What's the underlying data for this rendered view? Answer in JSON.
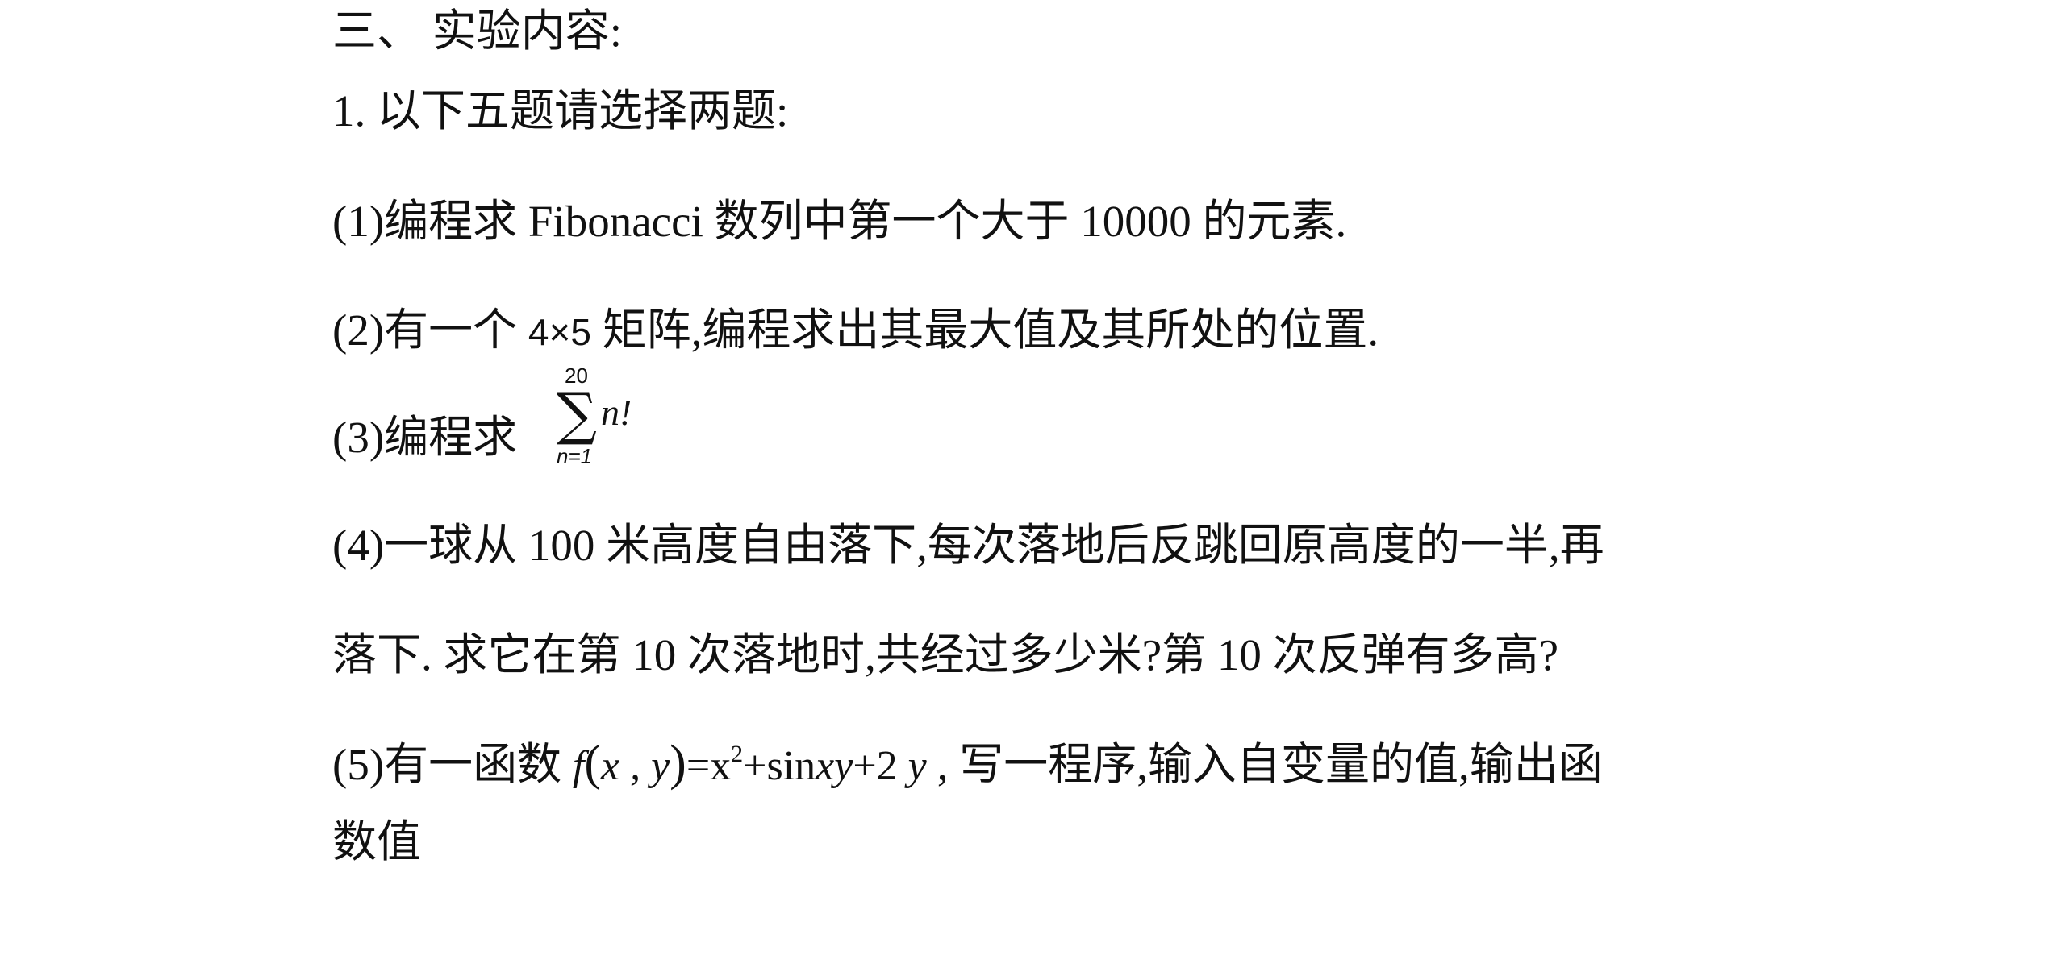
{
  "section": {
    "heading": "三、  实验内容:"
  },
  "task": {
    "intro": "1. 以下五题请选择两题:",
    "items": [
      {
        "label": "(1)编程求  Fibonacci 数列中第一个大于 10000 的元素."
      },
      {
        "label_pre": "(2)有一个 ",
        "matrix": "4×5",
        "label_post": " 矩阵,编程求出其最大值及其所处的位置."
      },
      {
        "label_pre": "(3)编程求 ",
        "sum_upper": "20",
        "sum_sigma": "∑",
        "sum_body": "n!",
        "sum_lower": "n=1"
      },
      {
        "line1": "(4)一球从 100 米高度自由落下,每次落地后反跳回原高度的一半,再",
        "line2": "落下. 求它在第 10 次落地时,共经过多少米?第 10 次反弹有多高?"
      },
      {
        "label_pre": "(5)有一函数 ",
        "formula_f": "f",
        "formula_args": "x , y",
        "formula_rhs_a": "=x",
        "formula_exp": "2",
        "formula_rhs_b": "+sin",
        "formula_xy": "xy",
        "formula_rhs_c": "+2 ",
        "formula_y": "y",
        "label_post": " , 写一程序,输入自变量的值,输出函",
        "line2": "数值"
      }
    ]
  }
}
